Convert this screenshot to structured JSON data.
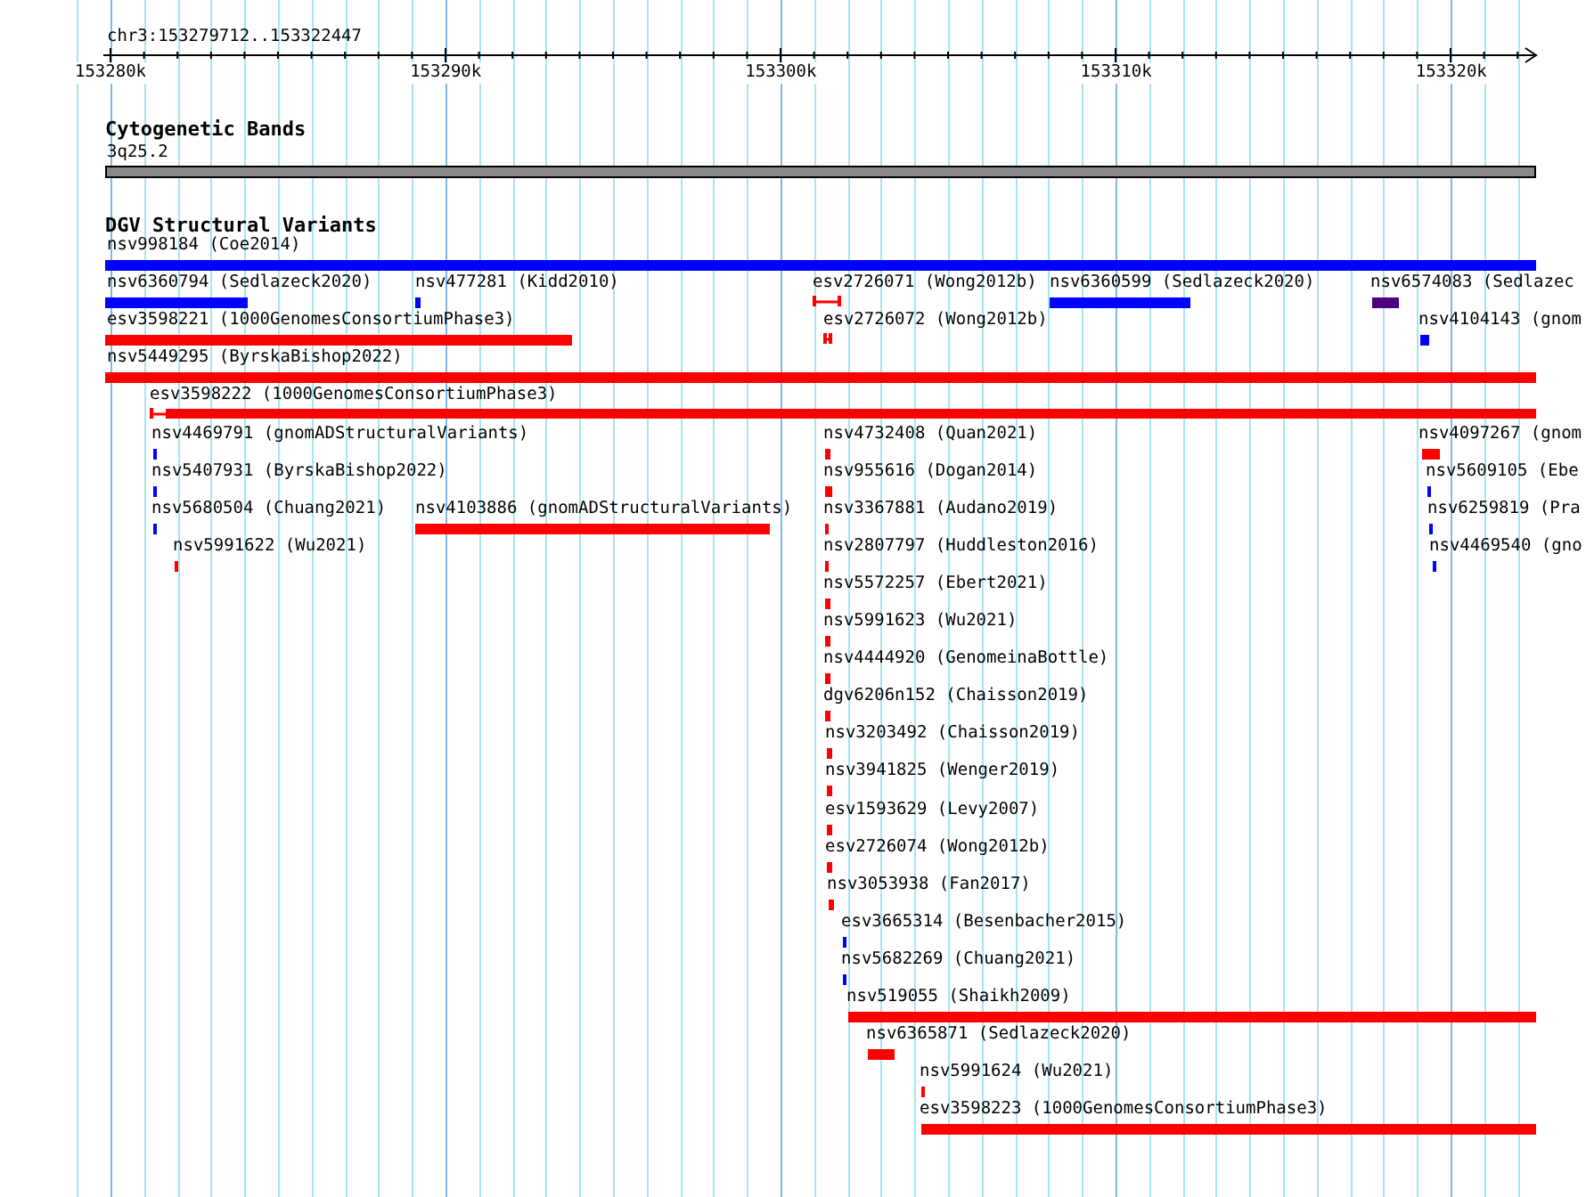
{
  "ruler": {
    "region": "chr3:153279712..153322447",
    "ticks": [
      "153280k",
      "153290k",
      "153300k",
      "153310k",
      "153320k"
    ]
  },
  "cytogenetic_bands": {
    "title": "Cytogenetic Bands",
    "band_label": "3q25.2"
  },
  "dgv_track": {
    "title": "DGV Structural Variants",
    "features": [
      {
        "label": "nsv998184 (Coe2014)",
        "color": "#0000ff",
        "kind": "block"
      },
      {
        "label": "nsv6360794 (Sedlazeck2020)",
        "color": "#0000ff",
        "kind": "block"
      },
      {
        "label": "nsv477281 (Kidd2010)",
        "color": "#0000ff",
        "kind": "block"
      },
      {
        "label": "esv2726071 (Wong2012b)",
        "color": "#ff0000",
        "kind": "bracket"
      },
      {
        "label": "nsv6360599 (Sedlazeck2020)",
        "color": "#0000ff",
        "kind": "block"
      },
      {
        "label": "nsv6574083 (Sedlazec",
        "color": "#4c0080",
        "kind": "block"
      },
      {
        "label": "esv3598221 (1000GenomesConsortiumPhase3)",
        "color": "#ff0000",
        "kind": "block"
      },
      {
        "label": "esv2726072 (Wong2012b)",
        "color": "#ff0000",
        "kind": "bracket"
      },
      {
        "label": "nsv4104143 (gnom",
        "color": "#0000ff",
        "kind": "block"
      },
      {
        "label": "nsv5449295 (ByrskaBishop2022)",
        "color": "#ff0000",
        "kind": "block"
      },
      {
        "label": "esv3598222 (1000GenomesConsortiumPhase3)",
        "color": "#ff0000",
        "kind": "tailed"
      },
      {
        "label": "nsv4469791 (gnomADStructuralVariants)",
        "color": "#0000ff",
        "kind": "block"
      },
      {
        "label": "nsv4732408 (Quan2021)",
        "color": "#ff0000",
        "kind": "block"
      },
      {
        "label": "nsv4097267 (gnom",
        "color": "#ff0000",
        "kind": "block"
      },
      {
        "label": "nsv5407931 (ByrskaBishop2022)",
        "color": "#0000ff",
        "kind": "block"
      },
      {
        "label": "nsv955616 (Dogan2014)",
        "color": "#ff0000",
        "kind": "block"
      },
      {
        "label": "nsv5609105 (Ebe",
        "color": "#0000ff",
        "kind": "block"
      },
      {
        "label": "nsv5680504 (Chuang2021)",
        "color": "#0000ff",
        "kind": "block"
      },
      {
        "label": "nsv4103886 (gnomADStructuralVariants)",
        "color": "#ff0000",
        "kind": "block"
      },
      {
        "label": "nsv3367881 (Audano2019)",
        "color": "#ff0000",
        "kind": "block"
      },
      {
        "label": "nsv6259819 (Pra",
        "color": "#0000ff",
        "kind": "block"
      },
      {
        "label": "nsv5991622 (Wu2021)",
        "color": "#ff0000",
        "kind": "block"
      },
      {
        "label": "nsv2807797 (Huddleston2016)",
        "color": "#ff0000",
        "kind": "block"
      },
      {
        "label": "nsv4469540 (gno",
        "color": "#0000ff",
        "kind": "block"
      },
      {
        "label": "nsv5572257 (Ebert2021)",
        "color": "#ff0000",
        "kind": "block"
      },
      {
        "label": "nsv5991623 (Wu2021)",
        "color": "#ff0000",
        "kind": "block"
      },
      {
        "label": "nsv4444920 (GenomeinaBottle)",
        "color": "#ff0000",
        "kind": "block"
      },
      {
        "label": "dgv6206n152 (Chaisson2019)",
        "color": "#ff0000",
        "kind": "block"
      },
      {
        "label": "nsv3203492 (Chaisson2019)",
        "color": "#ff0000",
        "kind": "block"
      },
      {
        "label": "nsv3941825 (Wenger2019)",
        "color": "#ff0000",
        "kind": "block"
      },
      {
        "label": "esv1593629 (Levy2007)",
        "color": "#ff0000",
        "kind": "block"
      },
      {
        "label": "esv2726074 (Wong2012b)",
        "color": "#ff0000",
        "kind": "block"
      },
      {
        "label": "nsv3053938 (Fan2017)",
        "color": "#ff0000",
        "kind": "block"
      },
      {
        "label": "esv3665314 (Besenbacher2015)",
        "color": "#0000ff",
        "kind": "block"
      },
      {
        "label": "nsv5682269 (Chuang2021)",
        "color": "#0000ff",
        "kind": "block"
      },
      {
        "label": "nsv519055 (Shaikh2009)",
        "color": "#ff0000",
        "kind": "block"
      },
      {
        "label": "nsv6365871 (Sedlazeck2020)",
        "color": "#ff0000",
        "kind": "block"
      },
      {
        "label": "nsv5991624 (Wu2021)",
        "color": "#ff0000",
        "kind": "block"
      },
      {
        "label": "esv3598223 (1000GenomesConsortiumPhase3)",
        "color": "#ff0000",
        "kind": "block"
      }
    ]
  }
}
